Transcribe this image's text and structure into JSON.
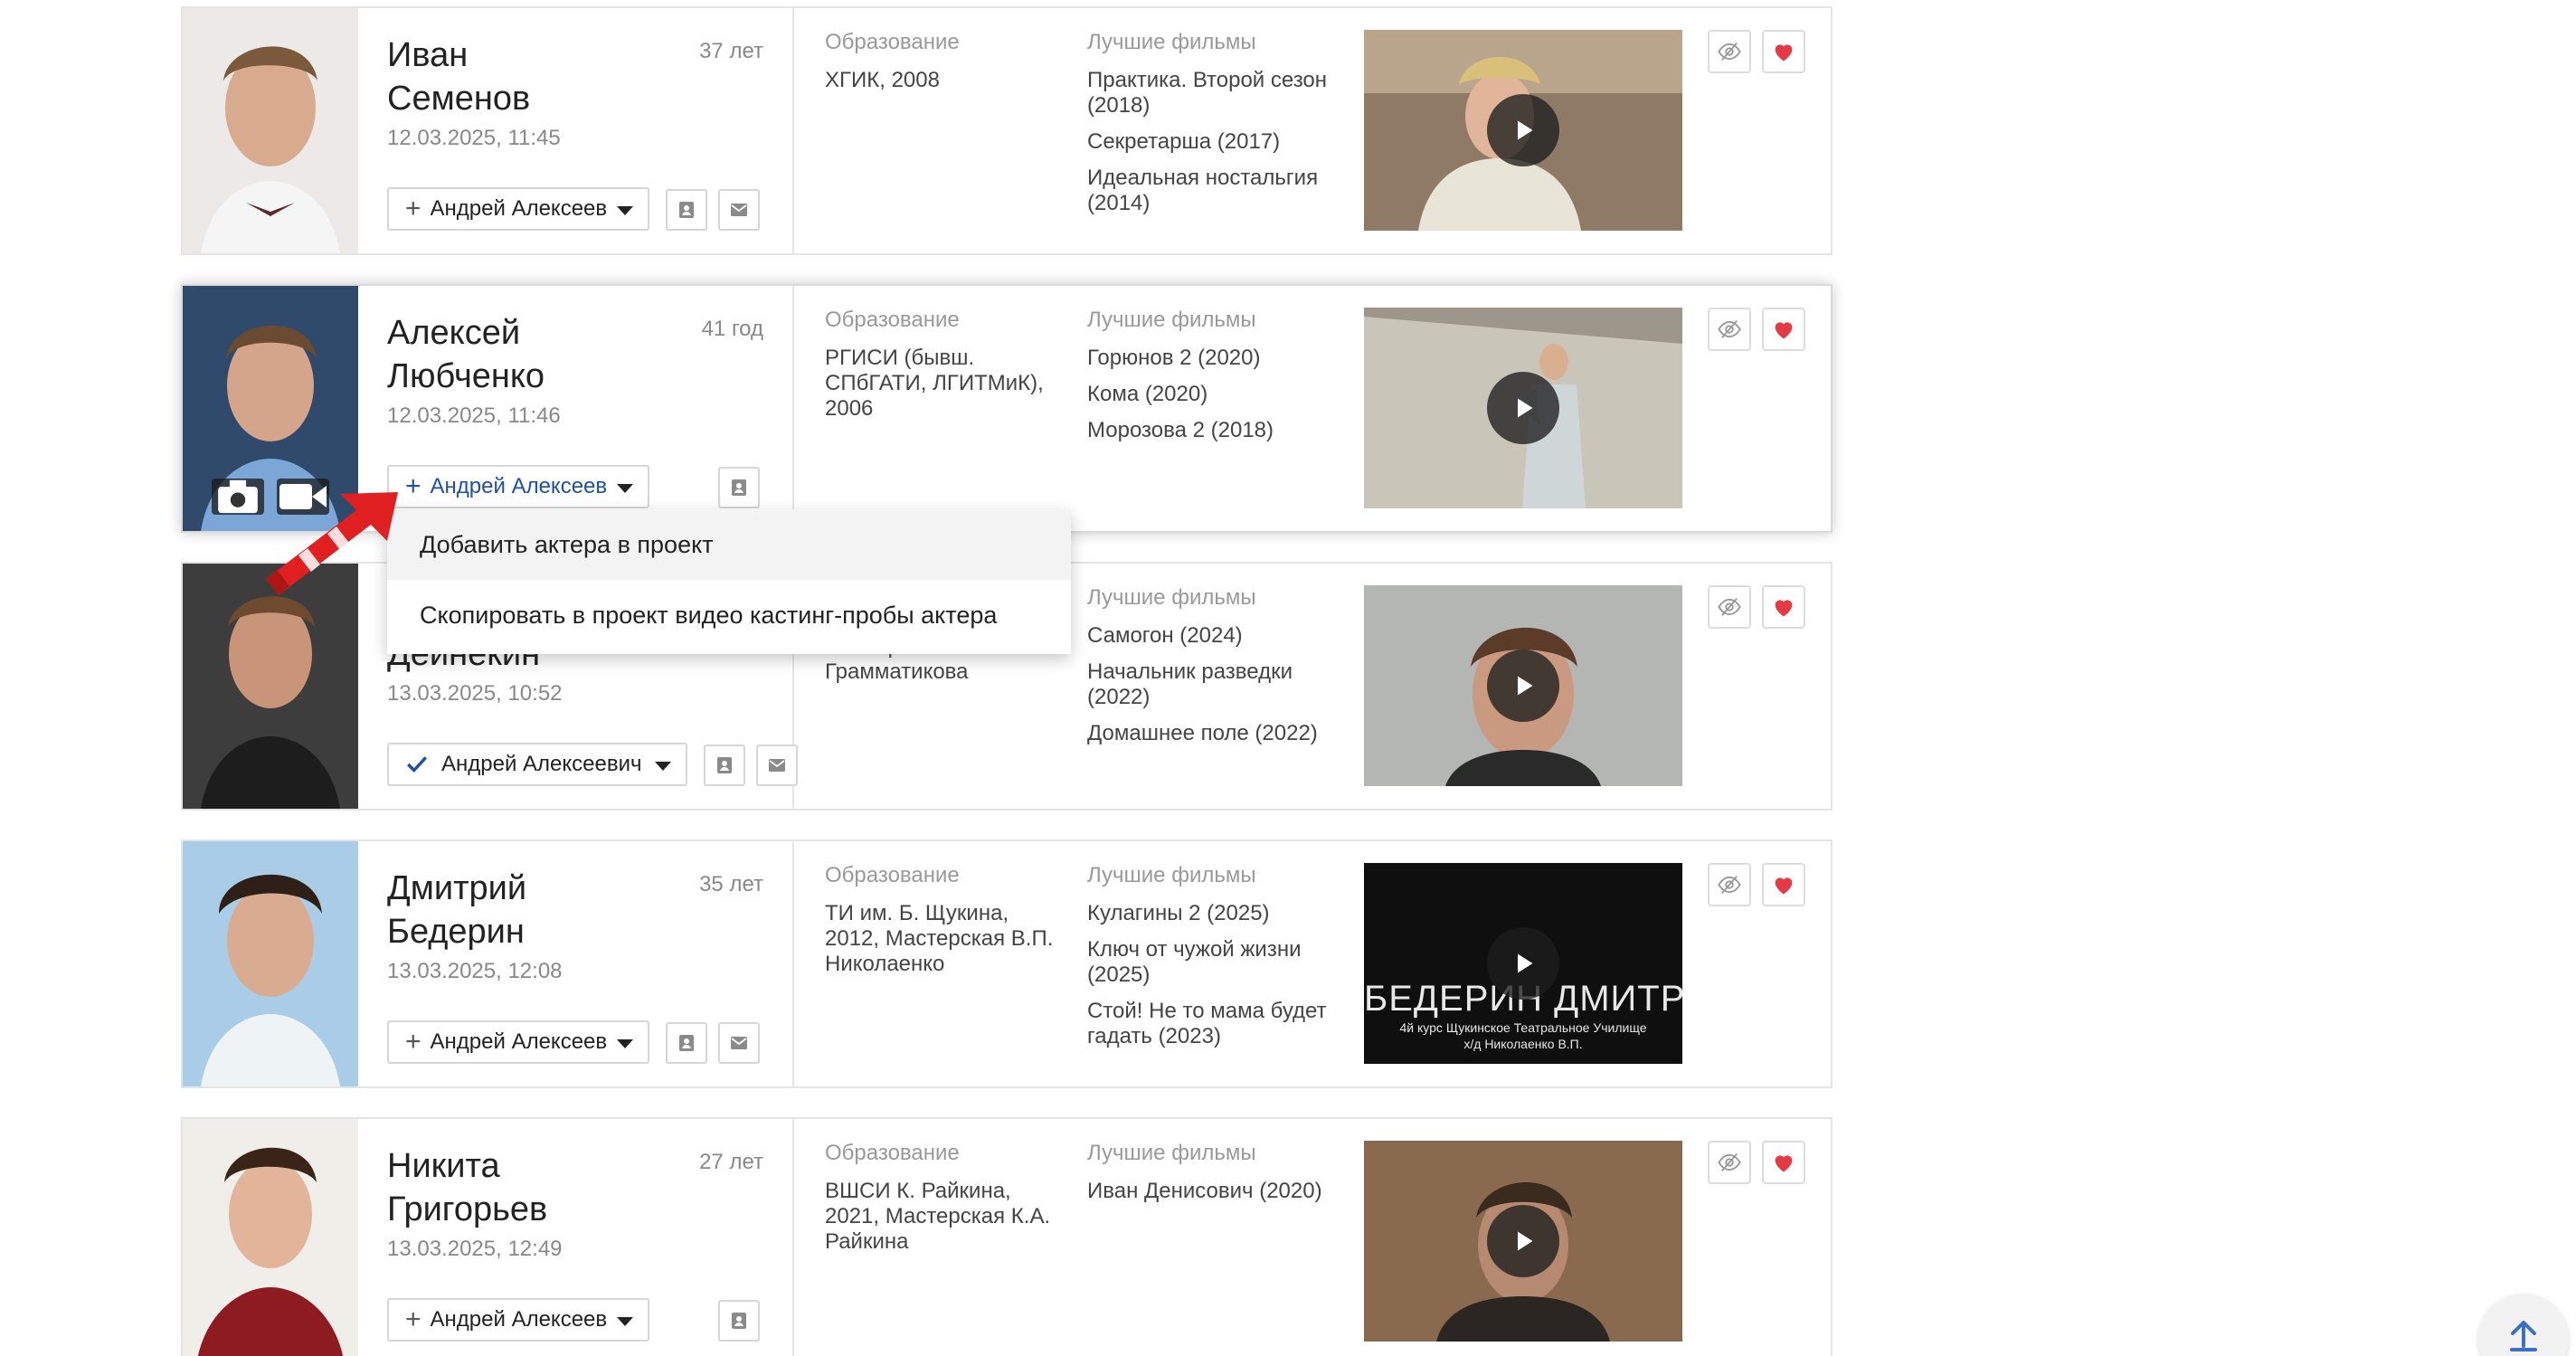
{
  "labels": {
    "education": "Образование",
    "best_films": "Лучшие фильмы"
  },
  "colors": {
    "accent_blue": "#1f4fa8",
    "heart_red": "#e53945",
    "pointer_red": "#e02020"
  },
  "icons": {
    "add": "+",
    "check": "check-icon",
    "dropdown": "chevron-down-icon",
    "contact": "contact-card-icon",
    "mail": "mail-icon",
    "camera": "camera-icon",
    "video": "video-camera-icon",
    "play": "play-icon",
    "hide": "eye-off-icon",
    "favorite": "heart-icon",
    "scroll_top": "arrow-up-icon"
  },
  "dropdown": {
    "items": [
      "Добавить актера в проект",
      "Скопировать в проект видео кастинг-пробы актера"
    ]
  },
  "actors": [
    {
      "first_name": "Иван",
      "last_name": "Семенов",
      "age": "37 лет",
      "date": "12.03.2025, 11:45",
      "project": "Андрей Алексеевич",
      "education": "ХГИК, 2008",
      "films": [
        "Практика. Второй сезон (2018)",
        "Секретарша (2017)",
        "Идеальная ностальгия (2014)"
      ]
    },
    {
      "first_name": "Алексей",
      "last_name": "Любченко",
      "age": "41 год",
      "date": "12.03.2025, 11:46",
      "project": "Андрей Алексеевич",
      "education": "РГИСИ (бывш. СПбГАТИ, ЛГИТМиК), 2006",
      "films": [
        "Горюнов 2 (2020)",
        "Кома (2020)",
        "Морозова 2 (2018)"
      ]
    },
    {
      "first_name": "",
      "last_name": "Деинекин",
      "age": "",
      "date": "13.03.2025, 10:52",
      "project": "Андрей Алексеевич",
      "education": "Мастерская В.А. Грамматикова",
      "films": [
        "Самогон (2024)",
        "Начальник разведки (2022)",
        "Домашнее поле (2022)"
      ]
    },
    {
      "first_name": "Дмитрий",
      "last_name": "Бедерин",
      "age": "35 лет",
      "date": "13.03.2025, 12:08",
      "project": "Андрей Алексеевич",
      "education": "ТИ им. Б. Щукина, 2012, Мастерская В.П. Николаенко",
      "films": [
        "Кулагины 2 (2025)",
        "Ключ от чужой жизни (2025)",
        "Стой! Не то мама будет гадать (2023)"
      ],
      "video_title": "БЕДЕРИН ДМИТРИЙ",
      "video_subtitle_1": "4й курс Щукинское Театральное Училище",
      "video_subtitle_2": "х/д Николаенко В.П."
    },
    {
      "first_name": "Никита",
      "last_name": "Григорьев",
      "age": "27 лет",
      "date": "13.03.2025, 12:49",
      "project": "Андрей Алексеевич",
      "education": "ВШСИ К. Райкина, 2021, Мастерская К.А. Райкина",
      "films": [
        "Иван Денисович (2020)"
      ]
    }
  ]
}
